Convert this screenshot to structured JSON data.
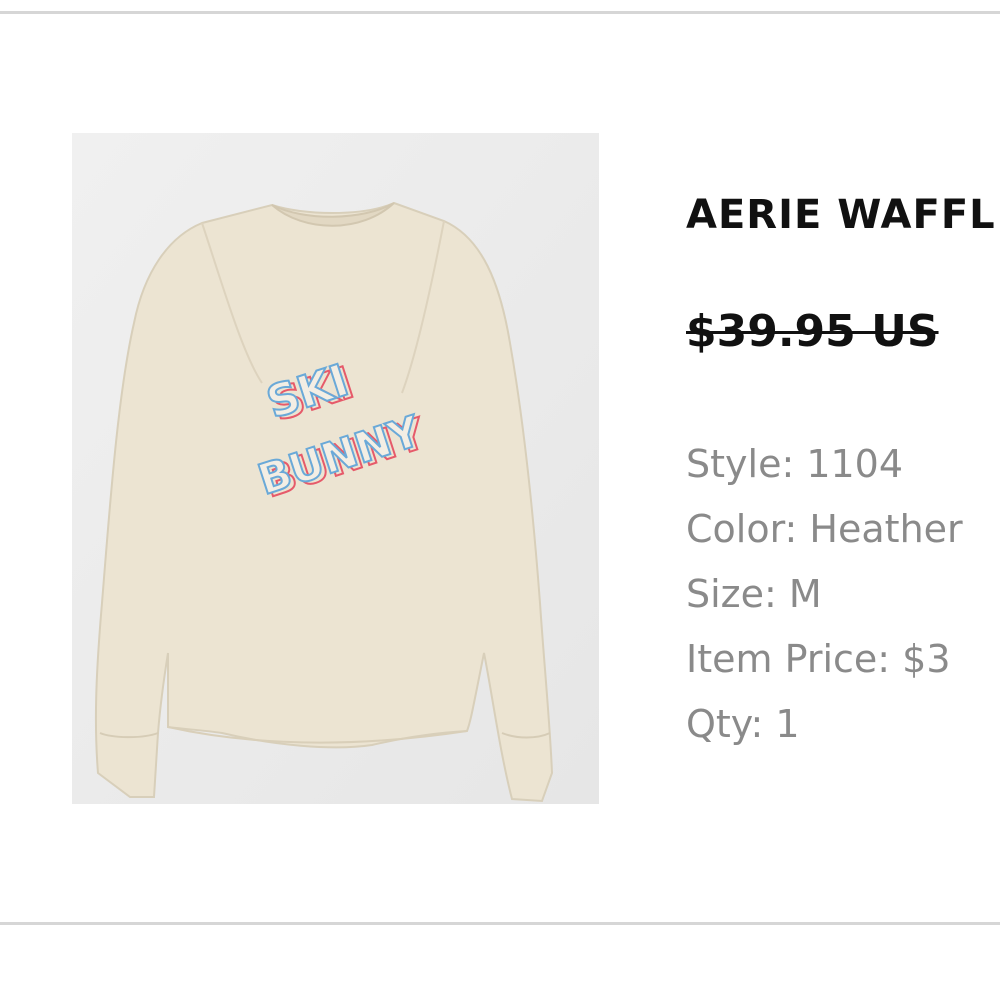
{
  "product": {
    "title": "AERIE WAFFL",
    "original_price": "$39.95 US",
    "image_alt": "SKI BUNNY long sleeve tee",
    "image_print_text": [
      "SKI",
      "BUNNY"
    ],
    "attributes": [
      {
        "label": "Style",
        "value": "1104",
        "text": "Style: 1104"
      },
      {
        "label": "Color",
        "value": "Heather",
        "text": "Color: Heather"
      },
      {
        "label": "Size",
        "value": "M",
        "text": "Size: M"
      },
      {
        "label": "Item Price",
        "value": "$3",
        "text": "Item Price: $3"
      },
      {
        "label": "Qty",
        "value": "1",
        "text": "Qty: 1"
      }
    ]
  },
  "colors": {
    "divider": "#d6d6d6",
    "title": "#111111",
    "attribute_text": "#8a8a8a",
    "image_background": "#ebebeb",
    "shirt": "#ece4d2"
  }
}
